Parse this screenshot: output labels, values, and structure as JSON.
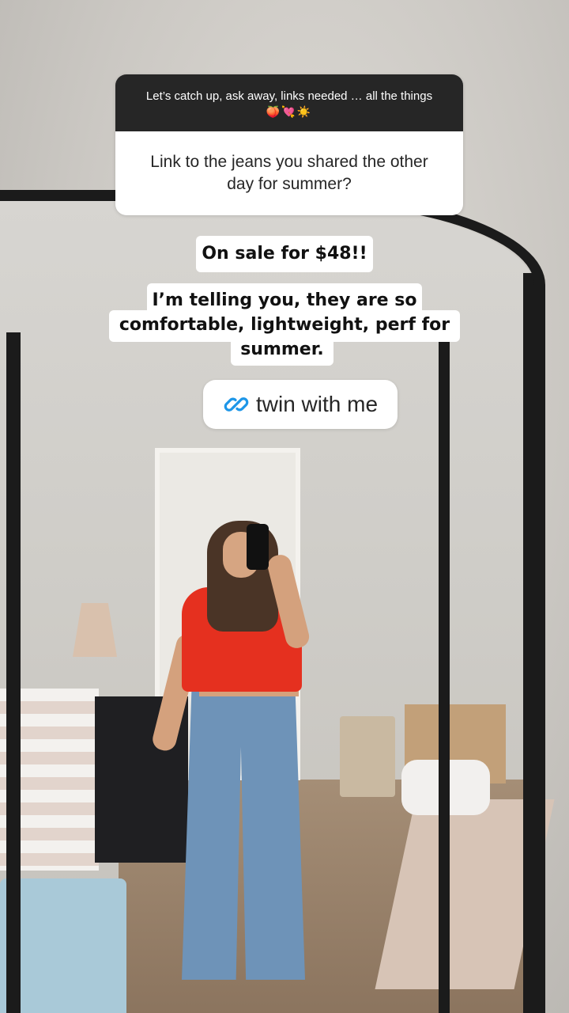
{
  "question_sticker": {
    "prompt": "Let’s catch up, ask away, links needed … all the things",
    "prompt_emojis": "🍑💘☀️",
    "question": "Link to the jeans you shared the other day for summer?"
  },
  "captions": {
    "line1": "On sale for $48!!",
    "line2a": "I’m telling you, they are so",
    "line2b": "comfortable, lightweight, perf for",
    "line2c": "summer."
  },
  "link_sticker": {
    "label": "twin with me",
    "icon": "link-icon",
    "icon_color": "#1d96e8"
  },
  "colors": {
    "sticker_header": "#262626",
    "sticker_body": "#ffffff"
  }
}
